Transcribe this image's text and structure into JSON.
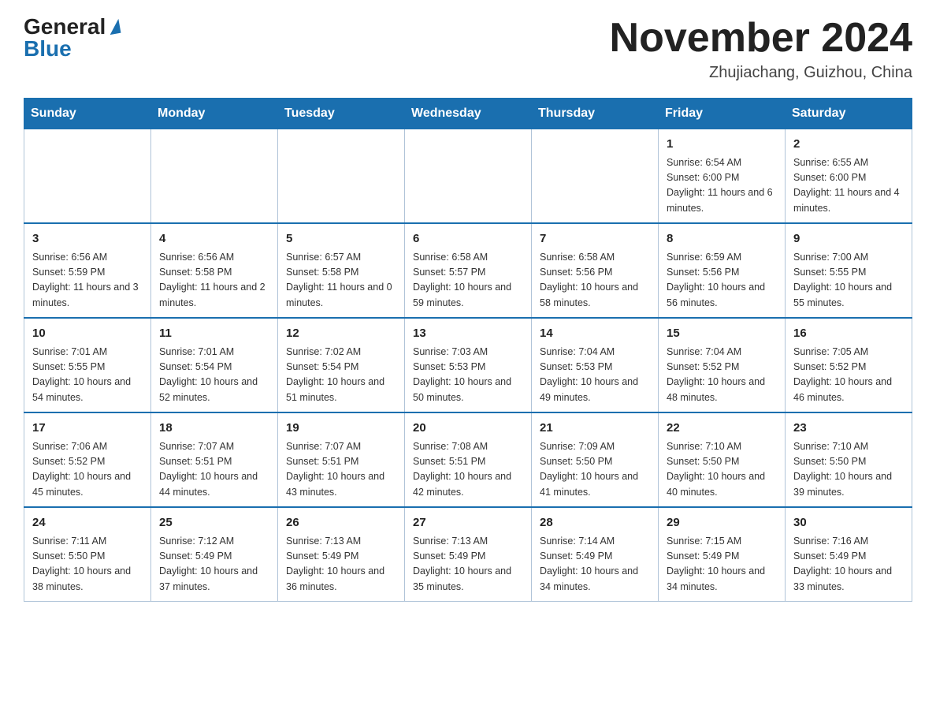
{
  "header": {
    "logo_general": "General",
    "logo_blue": "Blue",
    "month_title": "November 2024",
    "location": "Zhujiachang, Guizhou, China"
  },
  "days_of_week": [
    "Sunday",
    "Monday",
    "Tuesday",
    "Wednesday",
    "Thursday",
    "Friday",
    "Saturday"
  ],
  "weeks": [
    [
      {
        "day": "",
        "sunrise": "",
        "sunset": "",
        "daylight": ""
      },
      {
        "day": "",
        "sunrise": "",
        "sunset": "",
        "daylight": ""
      },
      {
        "day": "",
        "sunrise": "",
        "sunset": "",
        "daylight": ""
      },
      {
        "day": "",
        "sunrise": "",
        "sunset": "",
        "daylight": ""
      },
      {
        "day": "",
        "sunrise": "",
        "sunset": "",
        "daylight": ""
      },
      {
        "day": "1",
        "sunrise": "Sunrise: 6:54 AM",
        "sunset": "Sunset: 6:00 PM",
        "daylight": "Daylight: 11 hours and 6 minutes."
      },
      {
        "day": "2",
        "sunrise": "Sunrise: 6:55 AM",
        "sunset": "Sunset: 6:00 PM",
        "daylight": "Daylight: 11 hours and 4 minutes."
      }
    ],
    [
      {
        "day": "3",
        "sunrise": "Sunrise: 6:56 AM",
        "sunset": "Sunset: 5:59 PM",
        "daylight": "Daylight: 11 hours and 3 minutes."
      },
      {
        "day": "4",
        "sunrise": "Sunrise: 6:56 AM",
        "sunset": "Sunset: 5:58 PM",
        "daylight": "Daylight: 11 hours and 2 minutes."
      },
      {
        "day": "5",
        "sunrise": "Sunrise: 6:57 AM",
        "sunset": "Sunset: 5:58 PM",
        "daylight": "Daylight: 11 hours and 0 minutes."
      },
      {
        "day": "6",
        "sunrise": "Sunrise: 6:58 AM",
        "sunset": "Sunset: 5:57 PM",
        "daylight": "Daylight: 10 hours and 59 minutes."
      },
      {
        "day": "7",
        "sunrise": "Sunrise: 6:58 AM",
        "sunset": "Sunset: 5:56 PM",
        "daylight": "Daylight: 10 hours and 58 minutes."
      },
      {
        "day": "8",
        "sunrise": "Sunrise: 6:59 AM",
        "sunset": "Sunset: 5:56 PM",
        "daylight": "Daylight: 10 hours and 56 minutes."
      },
      {
        "day": "9",
        "sunrise": "Sunrise: 7:00 AM",
        "sunset": "Sunset: 5:55 PM",
        "daylight": "Daylight: 10 hours and 55 minutes."
      }
    ],
    [
      {
        "day": "10",
        "sunrise": "Sunrise: 7:01 AM",
        "sunset": "Sunset: 5:55 PM",
        "daylight": "Daylight: 10 hours and 54 minutes."
      },
      {
        "day": "11",
        "sunrise": "Sunrise: 7:01 AM",
        "sunset": "Sunset: 5:54 PM",
        "daylight": "Daylight: 10 hours and 52 minutes."
      },
      {
        "day": "12",
        "sunrise": "Sunrise: 7:02 AM",
        "sunset": "Sunset: 5:54 PM",
        "daylight": "Daylight: 10 hours and 51 minutes."
      },
      {
        "day": "13",
        "sunrise": "Sunrise: 7:03 AM",
        "sunset": "Sunset: 5:53 PM",
        "daylight": "Daylight: 10 hours and 50 minutes."
      },
      {
        "day": "14",
        "sunrise": "Sunrise: 7:04 AM",
        "sunset": "Sunset: 5:53 PM",
        "daylight": "Daylight: 10 hours and 49 minutes."
      },
      {
        "day": "15",
        "sunrise": "Sunrise: 7:04 AM",
        "sunset": "Sunset: 5:52 PM",
        "daylight": "Daylight: 10 hours and 48 minutes."
      },
      {
        "day": "16",
        "sunrise": "Sunrise: 7:05 AM",
        "sunset": "Sunset: 5:52 PM",
        "daylight": "Daylight: 10 hours and 46 minutes."
      }
    ],
    [
      {
        "day": "17",
        "sunrise": "Sunrise: 7:06 AM",
        "sunset": "Sunset: 5:52 PM",
        "daylight": "Daylight: 10 hours and 45 minutes."
      },
      {
        "day": "18",
        "sunrise": "Sunrise: 7:07 AM",
        "sunset": "Sunset: 5:51 PM",
        "daylight": "Daylight: 10 hours and 44 minutes."
      },
      {
        "day": "19",
        "sunrise": "Sunrise: 7:07 AM",
        "sunset": "Sunset: 5:51 PM",
        "daylight": "Daylight: 10 hours and 43 minutes."
      },
      {
        "day": "20",
        "sunrise": "Sunrise: 7:08 AM",
        "sunset": "Sunset: 5:51 PM",
        "daylight": "Daylight: 10 hours and 42 minutes."
      },
      {
        "day": "21",
        "sunrise": "Sunrise: 7:09 AM",
        "sunset": "Sunset: 5:50 PM",
        "daylight": "Daylight: 10 hours and 41 minutes."
      },
      {
        "day": "22",
        "sunrise": "Sunrise: 7:10 AM",
        "sunset": "Sunset: 5:50 PM",
        "daylight": "Daylight: 10 hours and 40 minutes."
      },
      {
        "day": "23",
        "sunrise": "Sunrise: 7:10 AM",
        "sunset": "Sunset: 5:50 PM",
        "daylight": "Daylight: 10 hours and 39 minutes."
      }
    ],
    [
      {
        "day": "24",
        "sunrise": "Sunrise: 7:11 AM",
        "sunset": "Sunset: 5:50 PM",
        "daylight": "Daylight: 10 hours and 38 minutes."
      },
      {
        "day": "25",
        "sunrise": "Sunrise: 7:12 AM",
        "sunset": "Sunset: 5:49 PM",
        "daylight": "Daylight: 10 hours and 37 minutes."
      },
      {
        "day": "26",
        "sunrise": "Sunrise: 7:13 AM",
        "sunset": "Sunset: 5:49 PM",
        "daylight": "Daylight: 10 hours and 36 minutes."
      },
      {
        "day": "27",
        "sunrise": "Sunrise: 7:13 AM",
        "sunset": "Sunset: 5:49 PM",
        "daylight": "Daylight: 10 hours and 35 minutes."
      },
      {
        "day": "28",
        "sunrise": "Sunrise: 7:14 AM",
        "sunset": "Sunset: 5:49 PM",
        "daylight": "Daylight: 10 hours and 34 minutes."
      },
      {
        "day": "29",
        "sunrise": "Sunrise: 7:15 AM",
        "sunset": "Sunset: 5:49 PM",
        "daylight": "Daylight: 10 hours and 34 minutes."
      },
      {
        "day": "30",
        "sunrise": "Sunrise: 7:16 AM",
        "sunset": "Sunset: 5:49 PM",
        "daylight": "Daylight: 10 hours and 33 minutes."
      }
    ]
  ]
}
